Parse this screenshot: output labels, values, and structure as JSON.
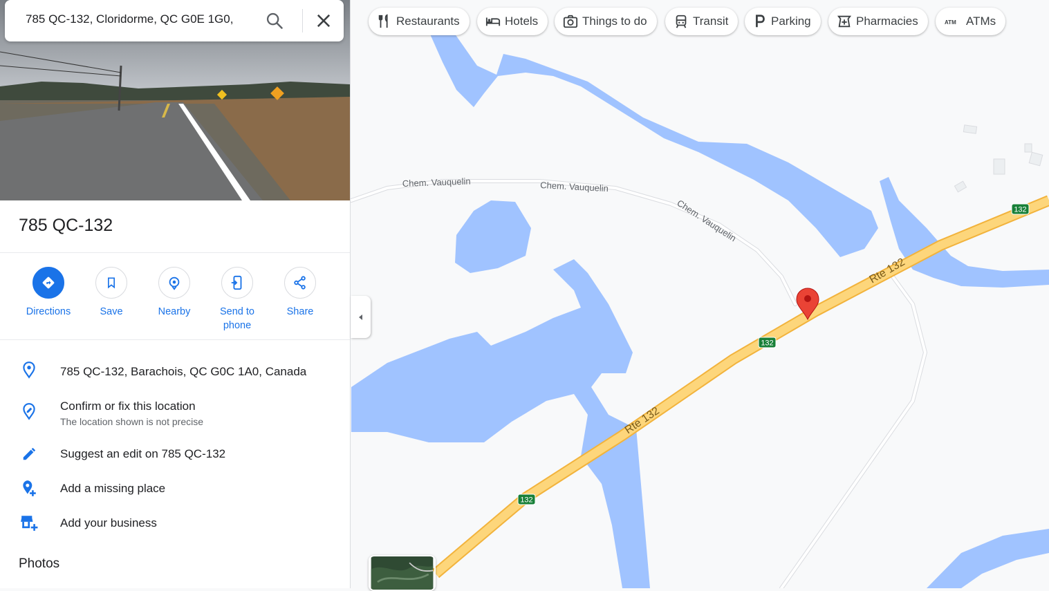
{
  "search": {
    "query": "785 QC-132, Cloridorme, QC G0E 1G0,"
  },
  "place": {
    "title": "785 QC-132"
  },
  "actions": [
    {
      "label": "Directions",
      "icon": "directions-icon"
    },
    {
      "label": "Save",
      "icon": "bookmark-icon"
    },
    {
      "label": "Nearby",
      "icon": "nearby-icon"
    },
    {
      "label": "Send to phone",
      "icon": "send-to-phone-icon"
    },
    {
      "label": "Share",
      "icon": "share-icon"
    }
  ],
  "info": {
    "address": "785 QC-132, Barachois, QC G0C 1A0, Canada",
    "confirm_title": "Confirm or fix this location",
    "confirm_sub": "The location shown is not precise",
    "suggest_edit": "Suggest an edit on 785 QC-132",
    "add_missing": "Add a missing place",
    "add_business": "Add your business"
  },
  "photos_heading": "Photos",
  "chips": [
    {
      "label": "Restaurants",
      "icon": "restaurant-icon"
    },
    {
      "label": "Hotels",
      "icon": "hotel-icon"
    },
    {
      "label": "Things to do",
      "icon": "camera-icon"
    },
    {
      "label": "Transit",
      "icon": "transit-icon"
    },
    {
      "label": "Parking",
      "icon": "parking-icon"
    },
    {
      "label": "Pharmacies",
      "icon": "pharmacy-icon"
    },
    {
      "label": "ATMs",
      "icon": "atm-icon"
    }
  ],
  "map": {
    "road_minor": "Chem. Vauquelin",
    "road_major": "Rte 132",
    "shield": "132"
  },
  "colors": {
    "accent": "#1a73e8",
    "water": "#a0c3ff",
    "road_major": "#fdd67b",
    "marker": "#ea4335"
  }
}
